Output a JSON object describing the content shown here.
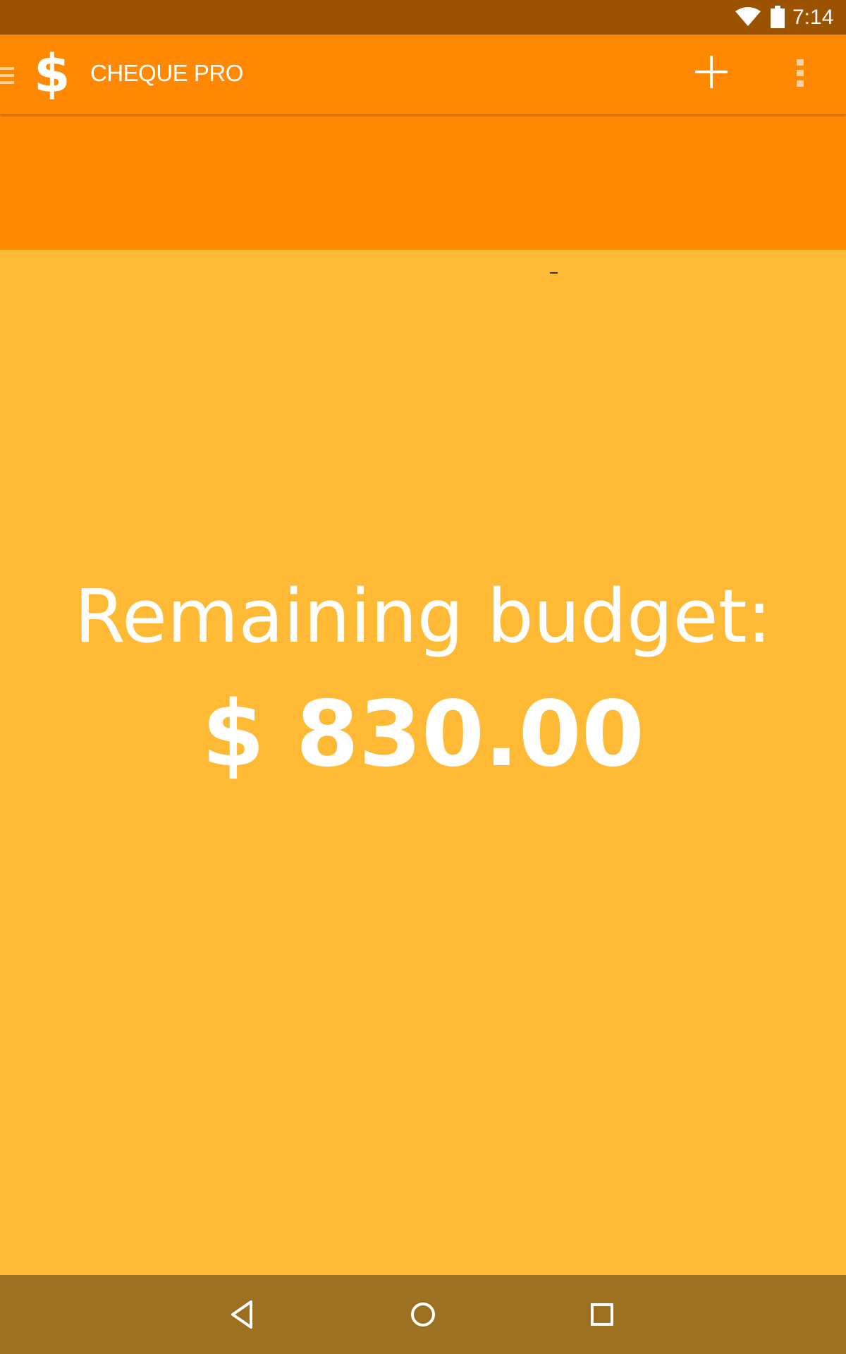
{
  "status_bar": {
    "time": "7:14",
    "icons": [
      "wifi-icon",
      "battery-icon"
    ]
  },
  "app_bar": {
    "logo_symbol": "$",
    "title": "CHEQUE PRO",
    "actions": [
      "add-icon",
      "overflow-menu-icon"
    ],
    "nav_icon": "hamburger-menu-icon"
  },
  "budget": {
    "label": "Remaining budget:",
    "amount": "$ 830.00"
  },
  "nav_bar": {
    "buttons": [
      "back-icon",
      "home-icon",
      "recents-icon"
    ]
  },
  "colors": {
    "status_bar": "#9B5300",
    "app_bar": "#FF8902",
    "content": "#FFBA35",
    "nav_bar": "#9B7020",
    "text": "#FFFFFF"
  }
}
